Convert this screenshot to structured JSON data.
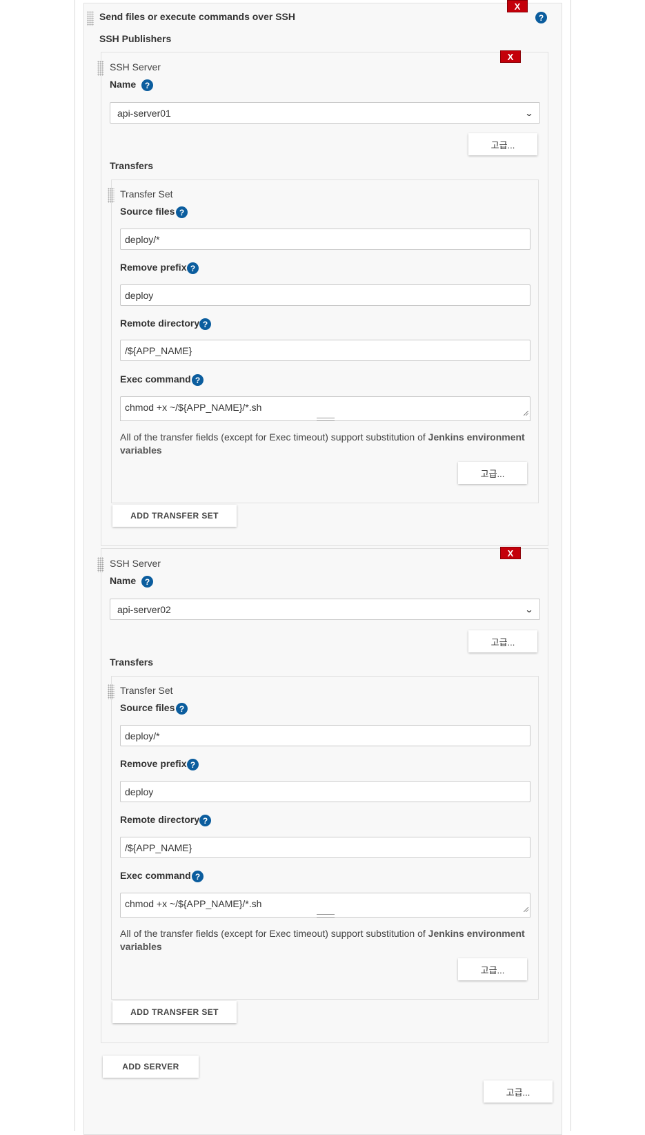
{
  "section": {
    "title": "Send files or execute commands over SSH",
    "publishers_label": "SSH Publishers",
    "delete_label": "X",
    "help_label": "?"
  },
  "servers": [
    {
      "header": "SSH Server",
      "name_label": "Name",
      "name_value": "api-server01",
      "advanced_label": "고급...",
      "transfers_label": "Transfers",
      "transfer_set": {
        "header": "Transfer Set",
        "source_files_label": "Source files",
        "source_files_value": "deploy/*",
        "remove_prefix_label": "Remove prefix",
        "remove_prefix_value": "deploy",
        "remote_directory_label": "Remote directory",
        "remote_directory_value": "/${APP_NAME}",
        "exec_command_label": "Exec command",
        "exec_command_value": "chmod +x ~/${APP_NAME}/*.sh",
        "note_text": "All of the transfer fields (except for Exec timeout) support substitution of ",
        "note_link": "Jenkins environment variables",
        "advanced_label": "고급..."
      },
      "add_transfer_set_label": "ADD TRANSFER SET"
    },
    {
      "header": "SSH Server",
      "name_label": "Name",
      "name_value": "api-server02",
      "advanced_label": "고급...",
      "transfers_label": "Transfers",
      "transfer_set": {
        "header": "Transfer Set",
        "source_files_label": "Source files",
        "source_files_value": "deploy/*",
        "remove_prefix_label": "Remove prefix",
        "remove_prefix_value": "deploy",
        "remote_directory_label": "Remote directory",
        "remote_directory_value": "/${APP_NAME}",
        "exec_command_label": "Exec command",
        "exec_command_value": "chmod +x ~/${APP_NAME}/*.sh",
        "note_text": "All of the transfer fields (except for Exec timeout) support substitution of ",
        "note_link": "Jenkins environment variables",
        "advanced_label": "고급..."
      },
      "add_transfer_set_label": "ADD TRANSFER SET"
    }
  ],
  "add_server_label": "ADD SERVER",
  "advanced_label": "고급...",
  "colors": {
    "delete_red": "#c4000a",
    "help_blue": "#0b5d9e",
    "panel_bg": "#f8f8f8"
  }
}
